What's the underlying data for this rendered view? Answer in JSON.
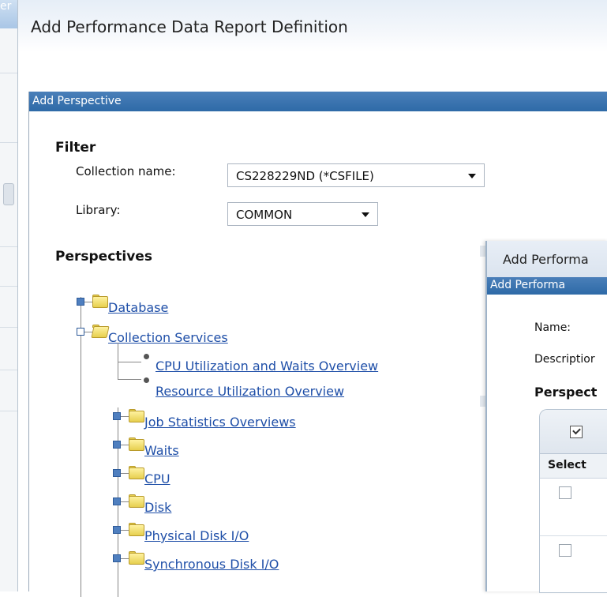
{
  "background": {
    "title_fragment": "er"
  },
  "dialog": {
    "title": "Add Performance Data Report Definition"
  },
  "perspective_panel": {
    "title": "Add Perspective",
    "filter": {
      "heading": "Filter",
      "collection_label": "Collection name:",
      "collection_value": "CS228229ND (*CSFILE)",
      "library_label": "Library:",
      "library_value": "COMMON"
    },
    "perspectives_heading": "Perspectives",
    "tree": [
      {
        "label": "Database",
        "state": "collapsed"
      },
      {
        "label": "Collection Services",
        "state": "expanded",
        "children": [
          "CPU Utilization and Waits Overview",
          "Resource Utilization Overview"
        ]
      },
      {
        "label": "Job Statistics Overviews",
        "state": "collapsed"
      },
      {
        "label": "Waits",
        "state": "collapsed"
      },
      {
        "label": "CPU",
        "state": "collapsed"
      },
      {
        "label": "Disk",
        "state": "collapsed"
      },
      {
        "label": "Physical Disk I/O",
        "state": "collapsed"
      },
      {
        "label": "Synchronous Disk I/O",
        "state": "collapsed"
      }
    ]
  },
  "inner_dialog": {
    "title": "Add Performa",
    "subtitle": "Add Performa",
    "name_label": "Name:",
    "description_label": "Descriptior",
    "perspectives_heading": "Perspect",
    "select_header": "Select"
  }
}
